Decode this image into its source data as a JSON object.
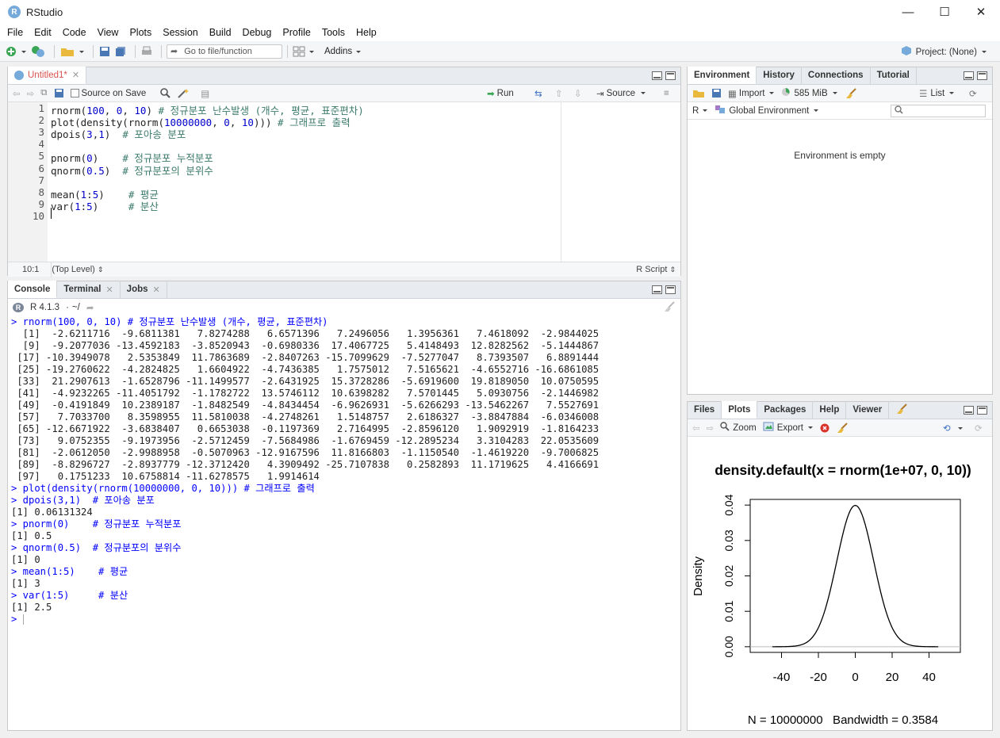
{
  "window": {
    "title": "RStudio",
    "logo_letter": "R",
    "controls": {
      "minimize": "—",
      "maximize": "☐",
      "close": "✕"
    }
  },
  "menu": [
    "File",
    "Edit",
    "Code",
    "View",
    "Plots",
    "Session",
    "Build",
    "Debug",
    "Profile",
    "Tools",
    "Help"
  ],
  "toolbar": {
    "goto_placeholder": "Go to file/function",
    "addins_label": "Addins",
    "project_label": "Project: (None)"
  },
  "editor": {
    "tab_label": "Untitled1*",
    "source_on_save_label": "Source on Save",
    "run_label": "Run",
    "source_label": "Source",
    "lines": [
      {
        "n": "1",
        "parts": [
          {
            "t": "rnorm(",
            "c": ""
          },
          {
            "t": "100",
            "c": "num"
          },
          {
            "t": ", ",
            "c": ""
          },
          {
            "t": "0",
            "c": "num"
          },
          {
            "t": ", ",
            "c": ""
          },
          {
            "t": "10",
            "c": "num"
          },
          {
            "t": ") ",
            "c": ""
          },
          {
            "t": "# 정규분포 난수발생 (개수, 평균, 표준편차)",
            "c": "com"
          }
        ]
      },
      {
        "n": "2",
        "parts": [
          {
            "t": "plot(density(rnorm(",
            "c": ""
          },
          {
            "t": "10000000",
            "c": "num"
          },
          {
            "t": ", ",
            "c": ""
          },
          {
            "t": "0",
            "c": "num"
          },
          {
            "t": ", ",
            "c": ""
          },
          {
            "t": "10",
            "c": "num"
          },
          {
            "t": "))) ",
            "c": ""
          },
          {
            "t": "# 그래프로 출력",
            "c": "com"
          }
        ]
      },
      {
        "n": "3",
        "parts": [
          {
            "t": "dpois(",
            "c": ""
          },
          {
            "t": "3",
            "c": "num"
          },
          {
            "t": ",",
            "c": ""
          },
          {
            "t": "1",
            "c": "num"
          },
          {
            "t": ")  ",
            "c": ""
          },
          {
            "t": "# 포아송 분포",
            "c": "com"
          }
        ]
      },
      {
        "n": "4",
        "parts": []
      },
      {
        "n": "5",
        "parts": [
          {
            "t": "pnorm(",
            "c": ""
          },
          {
            "t": "0",
            "c": "num"
          },
          {
            "t": ")    ",
            "c": ""
          },
          {
            "t": "# 정규분포 누적분포",
            "c": "com"
          }
        ]
      },
      {
        "n": "6",
        "parts": [
          {
            "t": "qnorm(",
            "c": ""
          },
          {
            "t": "0.5",
            "c": "num"
          },
          {
            "t": ")  ",
            "c": ""
          },
          {
            "t": "# 정규분포의 분위수",
            "c": "com"
          }
        ]
      },
      {
        "n": "7",
        "parts": []
      },
      {
        "n": "8",
        "parts": [
          {
            "t": "mean(",
            "c": ""
          },
          {
            "t": "1",
            "c": "num"
          },
          {
            "t": ":",
            "c": ""
          },
          {
            "t": "5",
            "c": "num"
          },
          {
            "t": ")    ",
            "c": ""
          },
          {
            "t": "# 평균",
            "c": "com"
          }
        ]
      },
      {
        "n": "9",
        "parts": [
          {
            "t": "var(",
            "c": ""
          },
          {
            "t": "1",
            "c": "num"
          },
          {
            "t": ":",
            "c": ""
          },
          {
            "t": "5",
            "c": "num"
          },
          {
            "t": ")     ",
            "c": ""
          },
          {
            "t": "# 분산",
            "c": "com"
          }
        ]
      },
      {
        "n": "10",
        "parts": []
      }
    ],
    "status": {
      "position": "10:1",
      "scope": "(Top Level)",
      "file_type": "R Script"
    }
  },
  "console": {
    "tabs": [
      {
        "label": "Console",
        "active": true
      },
      {
        "label": "Terminal",
        "active": false
      },
      {
        "label": "Jobs",
        "active": false
      }
    ],
    "r_version": "R 4.1.3",
    "wd": "~/",
    "lines": [
      {
        "t": "> rnorm(100, 0, 10) # 정규분포 난수발생 (개수, 평균, 표준편차)",
        "k": "cmd"
      },
      {
        "t": "  [1]  -2.6211716  -9.6811381   7.8274288   6.6571396   7.2496056   1.3956361   7.4618092  -2.9844025",
        "k": "res"
      },
      {
        "t": "  [9]  -9.2077036 -13.4592183  -3.8520943  -0.6980336  17.4067725   5.4148493  12.8282562  -5.1444867",
        "k": "res"
      },
      {
        "t": " [17] -10.3949078   2.5353849  11.7863689  -2.8407263 -15.7099629  -7.5277047   8.7393507   6.8891444",
        "k": "res"
      },
      {
        "t": " [25] -19.2760622  -4.2824825   1.6604922  -4.7436385   1.7575012   7.5165621  -4.6552716 -16.6861085",
        "k": "res"
      },
      {
        "t": " [33]  21.2907613  -1.6528796 -11.1499577  -2.6431925  15.3728286  -5.6919600  19.8189050  10.0750595",
        "k": "res"
      },
      {
        "t": " [41]  -4.9232265 -11.4051792  -1.1782722  13.5746112  10.6398282   7.5701445   5.0930756  -2.1446982",
        "k": "res"
      },
      {
        "t": " [49]  -0.4191849  10.2389187  -1.8482549  -4.8434454  -6.9626931  -5.6266293 -13.5462267   7.5527691",
        "k": "res"
      },
      {
        "t": " [57]   7.7033700   8.3598955  11.5810038  -4.2748261   1.5148757   2.6186327  -3.8847884  -6.0346008",
        "k": "res"
      },
      {
        "t": " [65] -12.6671922  -3.6838407   0.6653038  -0.1197369   2.7164995  -2.8596120   1.9092919  -1.8164233",
        "k": "res"
      },
      {
        "t": " [73]   9.0752355  -9.1973956  -2.5712459  -7.5684986  -1.6769459 -12.2895234   3.3104283  22.0535609",
        "k": "res"
      },
      {
        "t": " [81]  -2.0612050  -2.9988958  -0.5070963 -12.9167596  11.8166803  -1.1150540  -1.4619220  -9.7006825",
        "k": "res"
      },
      {
        "t": " [89]  -8.8296727  -2.8937779 -12.3712420   4.3909492 -25.7107838   0.2582893  11.1719625   4.4166691",
        "k": "res"
      },
      {
        "t": " [97]   0.1751233  10.6758814 -11.6278575   1.9914614",
        "k": "res"
      },
      {
        "t": "> plot(density(rnorm(10000000, 0, 10))) # 그래프로 출력",
        "k": "cmd"
      },
      {
        "t": "> dpois(3,1)  # 포아송 분포",
        "k": "cmd"
      },
      {
        "t": "[1] 0.06131324",
        "k": "res"
      },
      {
        "t": "> pnorm(0)    # 정규분포 누적분포",
        "k": "cmd"
      },
      {
        "t": "[1] 0.5",
        "k": "res"
      },
      {
        "t": "> qnorm(0.5)  # 정규분포의 분위수",
        "k": "cmd"
      },
      {
        "t": "[1] 0",
        "k": "res"
      },
      {
        "t": "> mean(1:5)    # 평균",
        "k": "cmd"
      },
      {
        "t": "[1] 3",
        "k": "res"
      },
      {
        "t": "> var(1:5)     # 분산",
        "k": "cmd"
      },
      {
        "t": "[1] 2.5",
        "k": "res"
      },
      {
        "t": "> ",
        "k": "cmd"
      }
    ]
  },
  "environment": {
    "tabs": [
      {
        "label": "Environment",
        "active": true
      },
      {
        "label": "History",
        "active": false
      },
      {
        "label": "Connections",
        "active": false
      },
      {
        "label": "Tutorial",
        "active": false
      }
    ],
    "import_label": "Import",
    "memory_label": "585 MiB",
    "list_label": "List",
    "lang_label": "R",
    "scope_label": "Global Environment",
    "empty_message": "Environment is empty"
  },
  "files_pane": {
    "tabs": [
      {
        "label": "Files",
        "active": false
      },
      {
        "label": "Plots",
        "active": true
      },
      {
        "label": "Packages",
        "active": false
      },
      {
        "label": "Help",
        "active": false
      },
      {
        "label": "Viewer",
        "active": false
      }
    ],
    "zoom_label": "Zoom",
    "export_label": "Export"
  },
  "chart_data": {
    "type": "line",
    "title": "density.default(x = rnorm(1e+07, 0, 10))",
    "xlabel": "N = 10000000   Bandwidth = 0.3584",
    "ylabel": "Density",
    "xlim": [
      -57,
      57
    ],
    "ylim": [
      -0.0016,
      0.0416
    ],
    "xticks": [
      -40,
      -20,
      0,
      20,
      40
    ],
    "yticks": [
      0.0,
      0.01,
      0.02,
      0.03,
      0.04
    ],
    "ytick_labels": [
      "0.00",
      "0.01",
      "0.02",
      "0.03",
      "0.04"
    ],
    "series": [
      {
        "mean": 0,
        "sd": 10,
        "x_range": [
          -45,
          45
        ],
        "peak": 0.0399
      }
    ],
    "color": "#000000"
  }
}
